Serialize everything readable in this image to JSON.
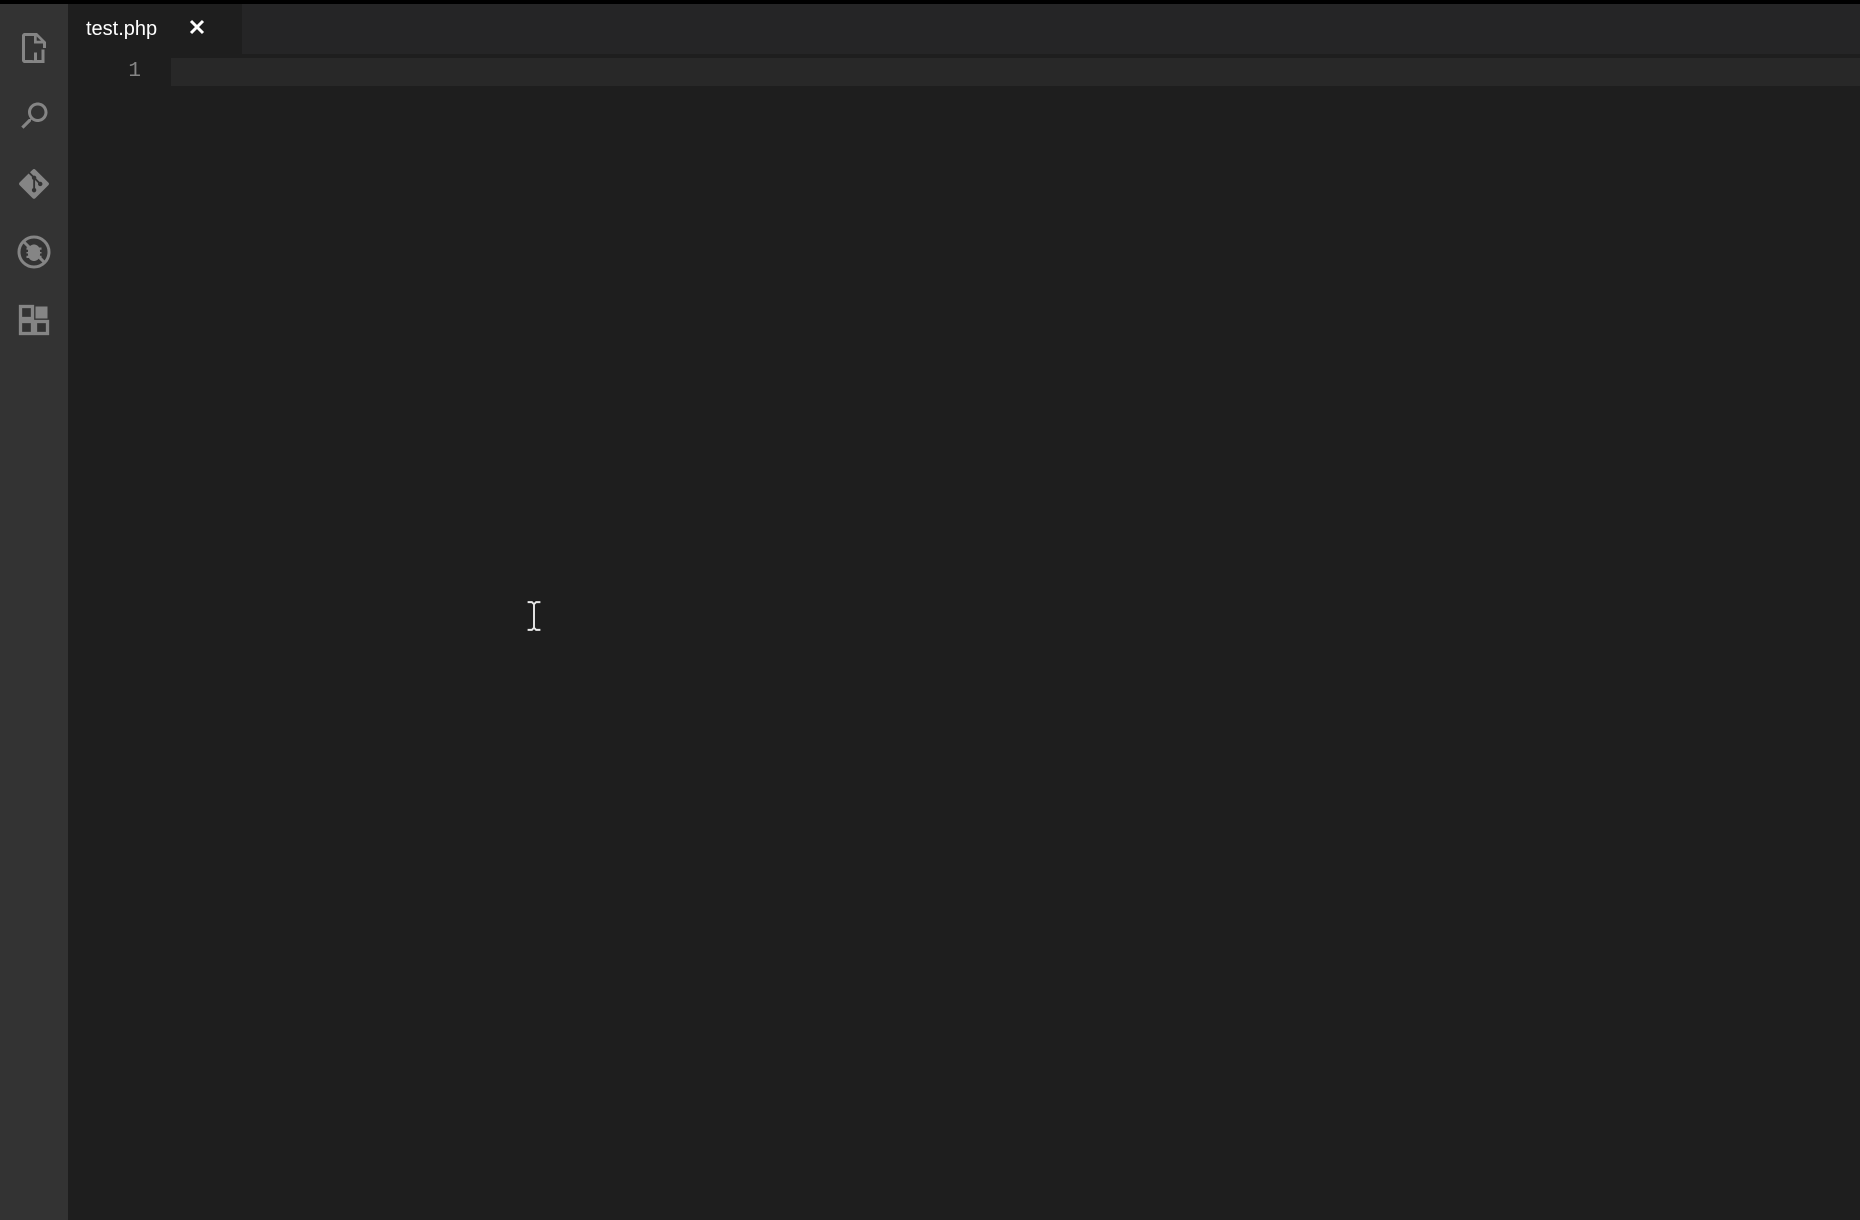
{
  "activityBar": {
    "items": [
      {
        "name": "explorer",
        "icon": "files-icon"
      },
      {
        "name": "search",
        "icon": "search-icon"
      },
      {
        "name": "source-control",
        "icon": "git-icon"
      },
      {
        "name": "debug",
        "icon": "debug-icon"
      },
      {
        "name": "extensions",
        "icon": "extensions-icon"
      }
    ]
  },
  "tabs": [
    {
      "label": "test.php",
      "active": true
    }
  ],
  "editor": {
    "lineNumbers": [
      "1"
    ],
    "content": ""
  }
}
